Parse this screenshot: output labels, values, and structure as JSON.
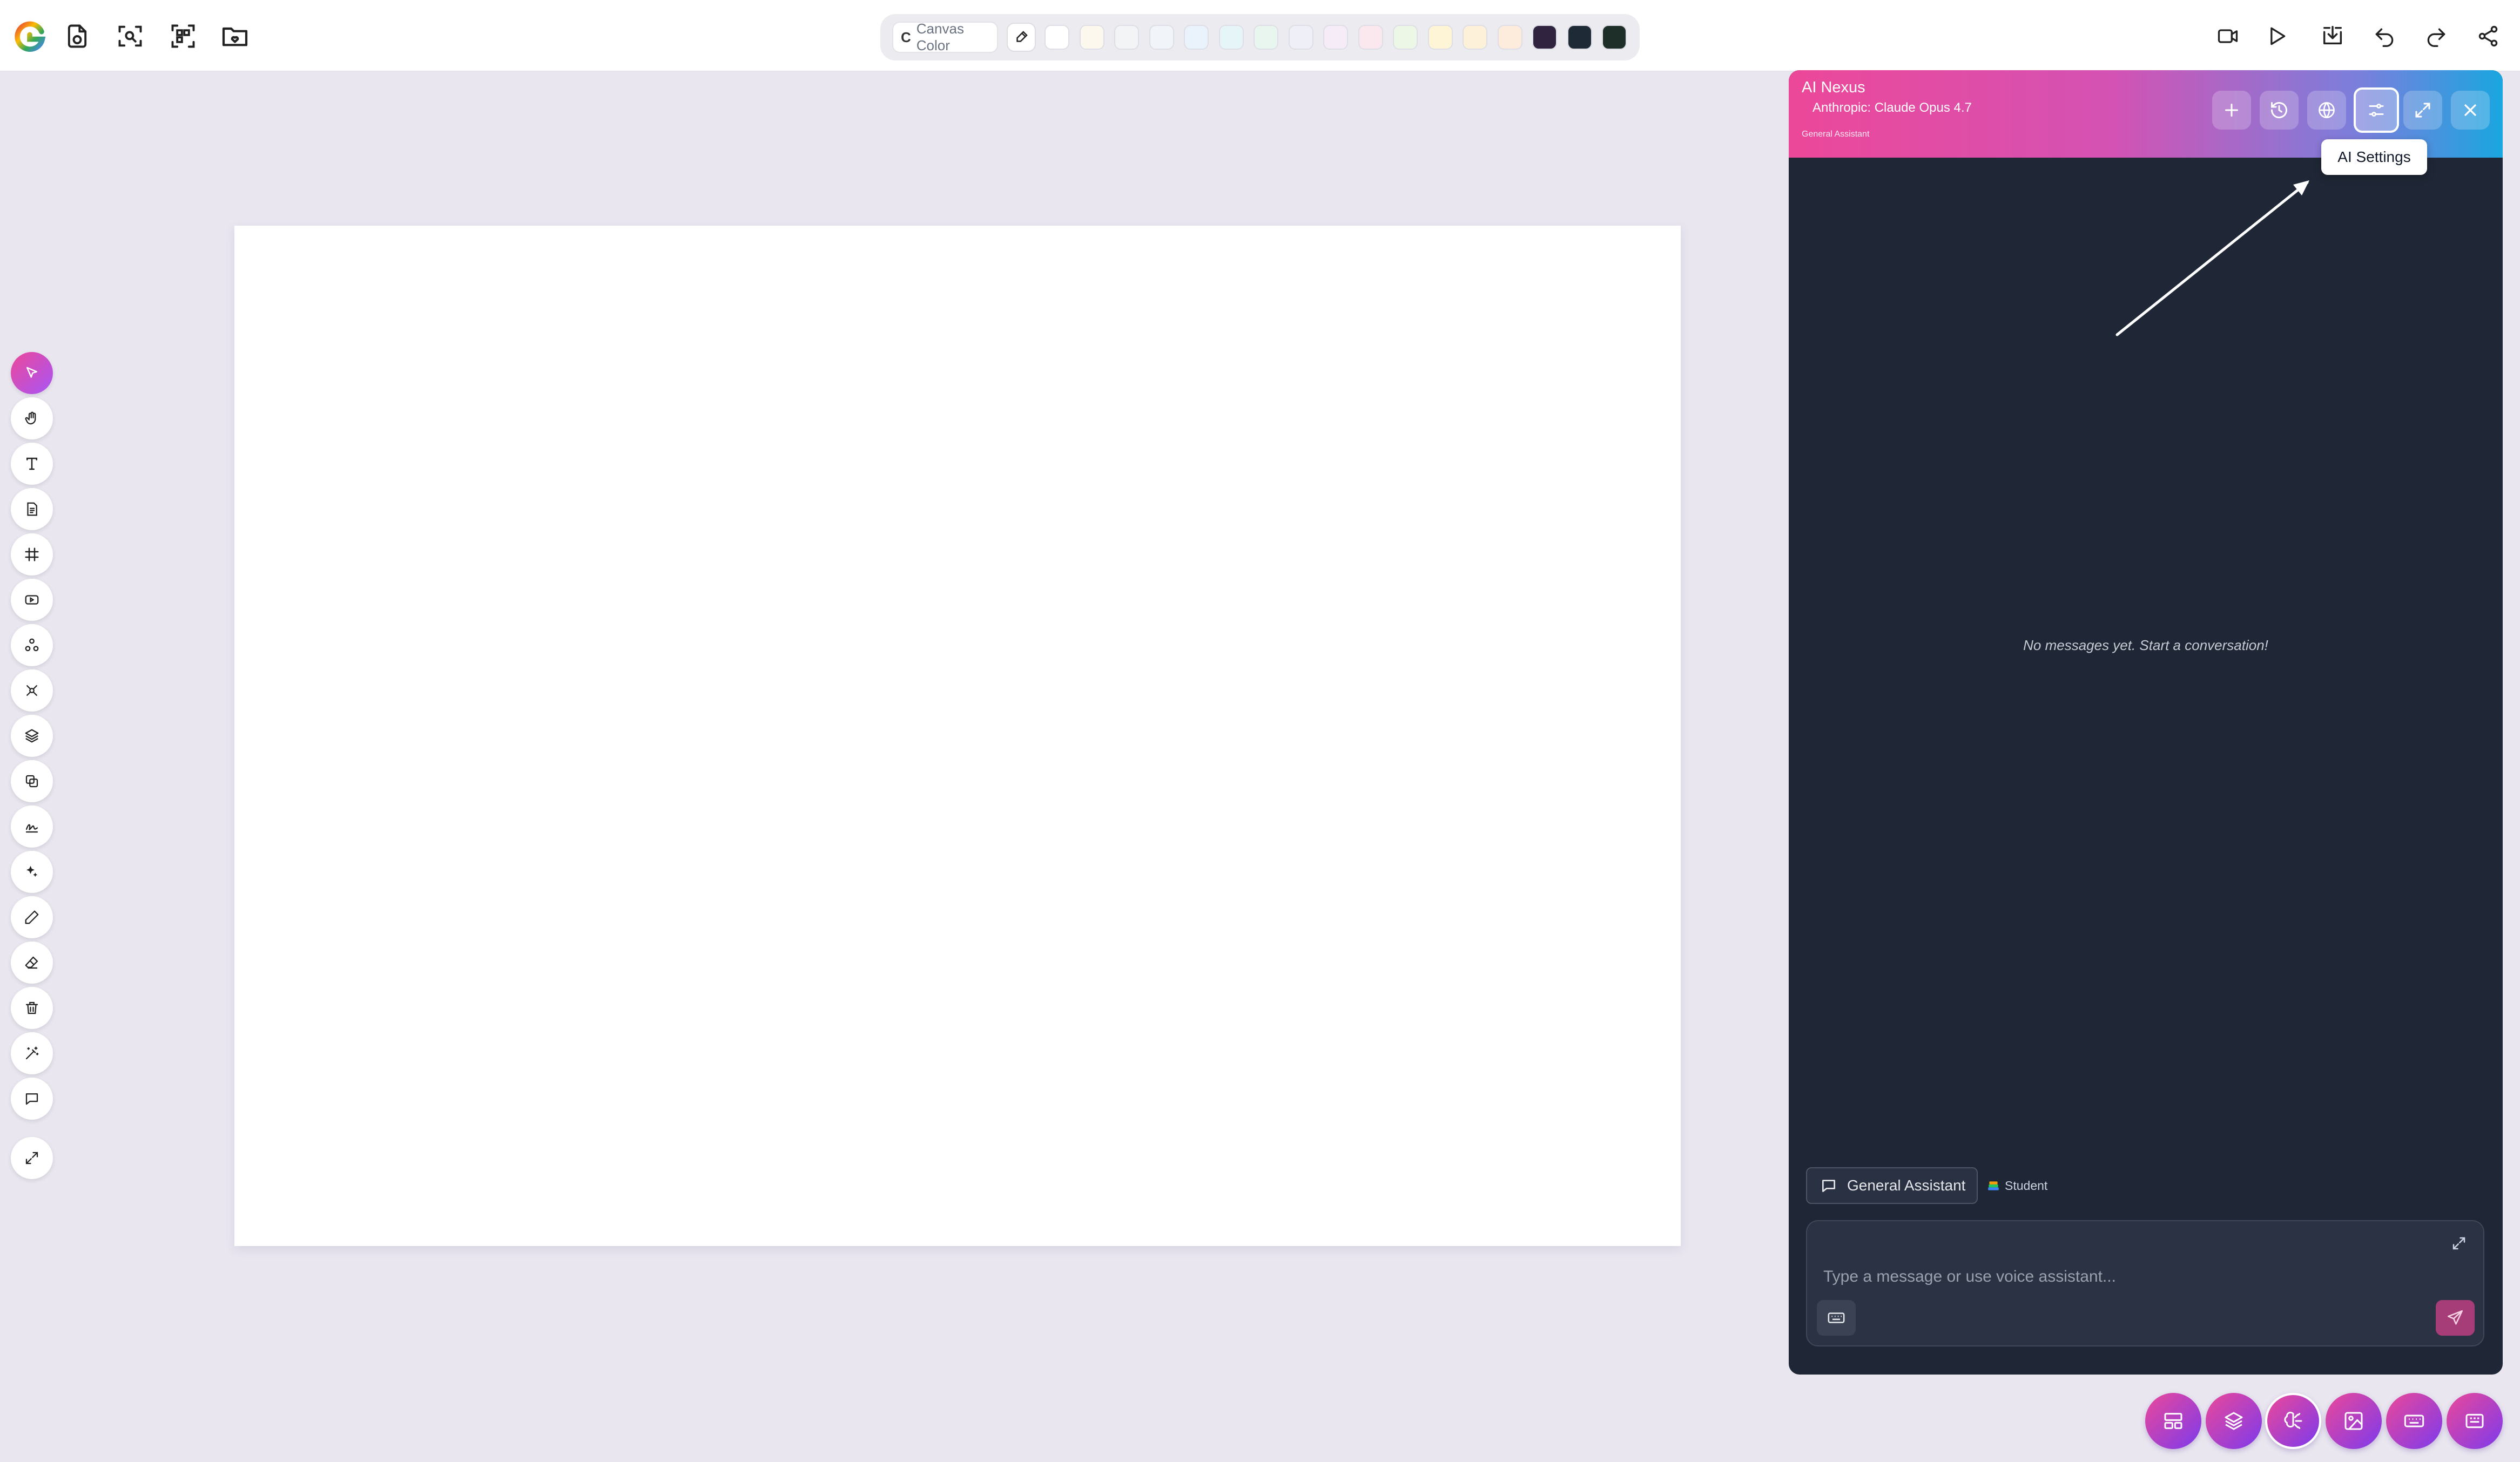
{
  "palette": {
    "canvas_color_initial": "C",
    "canvas_color_label": "Canvas Color",
    "swatches": [
      "#ffffff",
      "#fdf8ee",
      "#f3f4f6",
      "#f1f5f9",
      "#eaf2fc",
      "#e6f6f8",
      "#e8f6ef",
      "#efeff7",
      "#f6ecf8",
      "#fbe7ee",
      "#ecf7e6",
      "#fdf5d6",
      "#fdf1d9",
      "#fdebdb",
      "#2f2340",
      "#1f2a37",
      "#1e2f2a"
    ]
  },
  "ai_panel": {
    "title": "AI Nexus",
    "model": "Anthropic: Claude Opus 4.7",
    "mode_small": "General Assistant",
    "tooltip": "AI Settings",
    "empty_message": "No messages yet. Start a conversation!",
    "mode_chip": "General Assistant",
    "student_label": "Student",
    "input_placeholder": "Type a message or use voice assistant..."
  },
  "colors": {
    "accent_pink": "#ec4899",
    "accent_purple": "#a855f7",
    "panel_bg": "#1f2635",
    "canvas_bg": "#e9e6f0"
  },
  "icons": {
    "top_left": [
      "logo-icon",
      "new-file-icon",
      "zoom-fit-icon",
      "fit-to-screen-icon",
      "open-folder-icon"
    ],
    "top_right": [
      "record-icon",
      "play-icon",
      "download-icon",
      "undo-icon",
      "redo-icon",
      "share-icon"
    ],
    "left_toolbar": [
      "select-icon",
      "hand-icon",
      "text-icon",
      "sticky-note-icon",
      "frame-icon",
      "media-icon",
      "shapes-icon",
      "connector-icon",
      "layers-icon",
      "duplicate-icon",
      "signature-icon",
      "ai-sparkle-icon",
      "pencil-icon",
      "eraser-icon",
      "trash-icon",
      "magic-wand-icon",
      "comment-icon",
      "expand-icon"
    ],
    "ai_header": [
      "new-chat-icon",
      "history-icon",
      "globe-icon",
      "settings-sliders-icon",
      "maximize-icon",
      "close-icon"
    ],
    "fabs": [
      "templates-icon",
      "layers-fab-icon",
      "ai-brain-icon",
      "image-icon",
      "keyboard-shortcuts-icon",
      "keyboard-icon"
    ]
  }
}
